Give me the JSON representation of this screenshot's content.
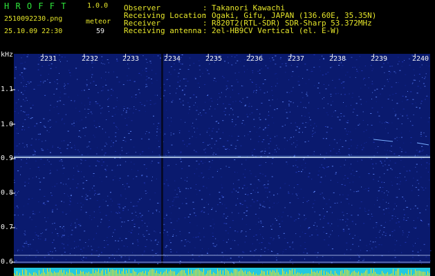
{
  "app": {
    "logo": "H R O F F T",
    "version": "1.0.0",
    "filename": "2510092230.png",
    "datetime": "25.10.09 22:30",
    "count_label": "meteor",
    "count_value": "59"
  },
  "header": {
    "rows": [
      {
        "label": "Observer",
        "sep": ":",
        "value": "Takanori Kawachi"
      },
      {
        "label": "Receiving Location",
        "sep": ":",
        "value": "Ogaki, Gifu, JAPAN (136.60E, 35.35N)"
      },
      {
        "label": "Receiver",
        "sep": ":",
        "value": "R820T2(RTL-SDR) SDR-Sharp 53.372MHz"
      },
      {
        "label": "Receiving antenna",
        "sep": ":",
        "value": "2el-HB9CV Vertical (el. E-W)"
      }
    ]
  },
  "axes": {
    "y_unit": "kHz",
    "x_ticks": [
      "2231",
      "2232",
      "2233",
      "2234",
      "2235",
      "2236",
      "2237",
      "2238",
      "2239",
      "2240"
    ],
    "y_ticks": [
      "1.1",
      "1.0",
      "0.9",
      "0.8",
      "0.7",
      "0.6"
    ]
  },
  "colors": {
    "background": "#000000",
    "noise": "#0a1a6e",
    "carrier": "#d8f0ff",
    "text_green": "#2ee63a",
    "text_yellow": "#e6e62a"
  }
}
